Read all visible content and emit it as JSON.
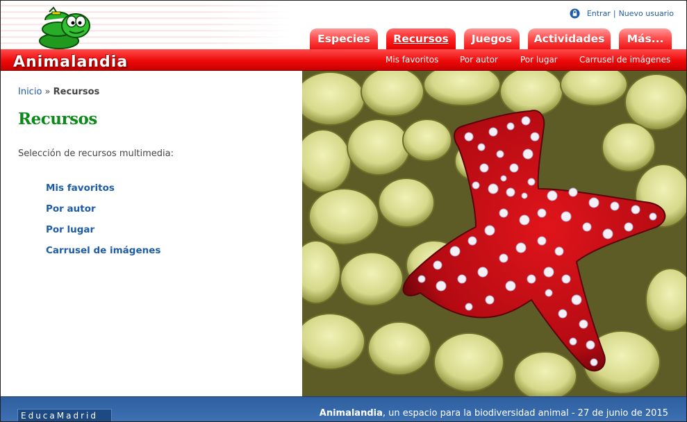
{
  "site": {
    "logo_text": "Animalandia"
  },
  "login": {
    "enter": "Entrar",
    "separator": "|",
    "new_user": "Nuevo usuario"
  },
  "tabs": [
    {
      "label": "Especies",
      "active": false
    },
    {
      "label": "Recursos",
      "active": true
    },
    {
      "label": "Juegos",
      "active": false
    },
    {
      "label": "Actividades",
      "active": false
    },
    {
      "label": "Más...",
      "active": false
    }
  ],
  "subnav": [
    "Mis favoritos",
    "Por autor",
    "Por lugar",
    "Carrusel de imágenes"
  ],
  "breadcrumb": {
    "home": "Inicio",
    "separator": "»",
    "current": "Recursos"
  },
  "main": {
    "title": "Recursos",
    "intro": "Selección de recursos multimedia:",
    "links": [
      "Mis favoritos",
      "Por autor",
      "Por lugar",
      "Carrusel de imágenes"
    ]
  },
  "footer": {
    "educa_logo": "EducaMadrid",
    "site_name": "Animalandia",
    "tagline": ", un espacio para la biodiversidad animal - 27 de junio de 2015"
  },
  "colors": {
    "red_bar": "#ee0a0a",
    "link_blue": "#1d5ca6",
    "title_green": "#0b8a1a",
    "footer_blue": "#3d72b4"
  },
  "icons": {
    "lock": "lock-icon",
    "snake_logo": "snake-logo",
    "photo": "starfish-photo"
  }
}
